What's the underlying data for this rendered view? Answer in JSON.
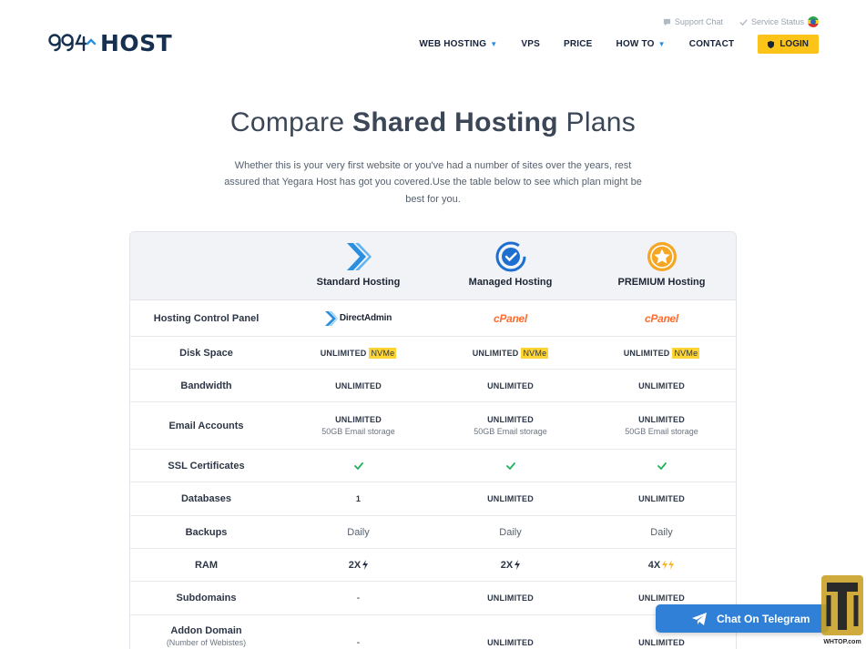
{
  "brand": {
    "logo_text": "HOST"
  },
  "topbar": {
    "support": "Support Chat",
    "status": "Service Status"
  },
  "nav": {
    "items": [
      {
        "label": "WEB HOSTING",
        "has_caret": true
      },
      {
        "label": "VPS",
        "has_caret": false
      },
      {
        "label": "PRICE",
        "has_caret": false
      },
      {
        "label": "HOW TO",
        "has_caret": true
      },
      {
        "label": "CONTACT",
        "has_caret": false
      }
    ],
    "login": "LOGIN"
  },
  "hero": {
    "title_a": "Compare ",
    "title_b": "Shared Hosting",
    "title_c": " Plans",
    "subtitle": "Whether this is your very first website or you've had a number of sites over the years, rest assured that Yegara Host has got you covered.Use the table below to see which plan might be best for you."
  },
  "plans": [
    {
      "name": "Standard Hosting",
      "icon": "arrow-chevron-icon",
      "color": "#2b8fe0"
    },
    {
      "name": "Managed Hosting",
      "icon": "check-circle-icon",
      "color": "#1f6fd1"
    },
    {
      "name": "PREMIUM Hosting",
      "icon": "star-circle-icon",
      "color": "#f5a623"
    }
  ],
  "rows": {
    "control_panel": {
      "label": "Hosting Control Panel",
      "standard": "DirectAdmin",
      "managed": "cPanel",
      "premium": "cPanel"
    },
    "disk": {
      "label": "Disk Space",
      "value": "UNLIMITED",
      "tag": "NVMe"
    },
    "bandwidth": {
      "label": "Bandwidth",
      "value": "UNLIMITED"
    },
    "email": {
      "label": "Email Accounts",
      "value": "UNLIMITED",
      "sub": "50GB Email storage"
    },
    "ssl": {
      "label": "SSL Certificates"
    },
    "databases": {
      "label": "Databases",
      "standard": "1",
      "managed": "UNLIMITED",
      "premium": "UNLIMITED"
    },
    "backups": {
      "label": "Backups",
      "value": "Daily"
    },
    "ram": {
      "label": "RAM",
      "standard": "2X",
      "managed": "2X",
      "premium": "4X"
    },
    "subdomains": {
      "label": "Subdomains",
      "standard": "-",
      "managed": "UNLIMITED",
      "premium": "UNLIMITED"
    },
    "addon": {
      "label": "Addon Domain",
      "sub": "(Number of Webistes)",
      "standard": "-",
      "managed": "UNLIMITED",
      "premium": "UNLIMITED"
    }
  },
  "telegram": {
    "label": "Chat On Telegram"
  },
  "watermark": {
    "text": "WHTOP.com"
  },
  "colors": {
    "accent_yellow": "#fcc419",
    "telegram_blue": "#2f80d6",
    "check_green": "#1fb25a",
    "cpanel_orange": "#ff6c2c"
  }
}
